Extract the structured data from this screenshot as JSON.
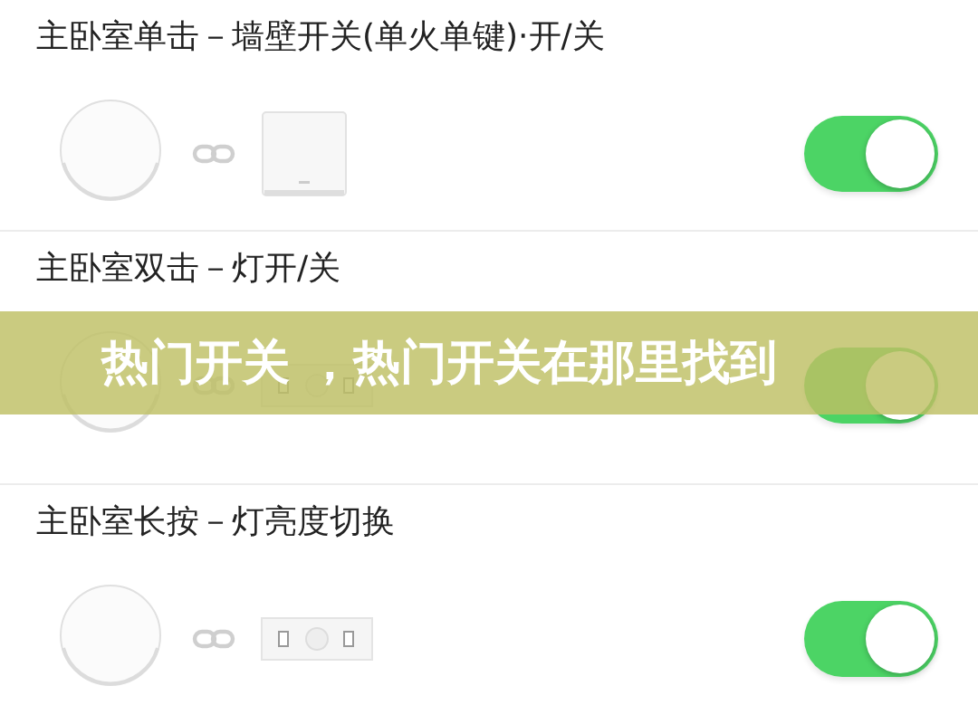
{
  "rules": [
    {
      "title": "主卧室单击－墙壁开关(单火单键)·开/关",
      "kind": "wall-switch",
      "on": true
    },
    {
      "title": "主卧室双击－灯开/关",
      "kind": "light-controller",
      "on": true
    },
    {
      "title": "主卧室长按－灯亮度切换",
      "kind": "light-controller",
      "on": true
    }
  ],
  "banner": {
    "text": "热门开关 ，热门开关在那里找到"
  }
}
